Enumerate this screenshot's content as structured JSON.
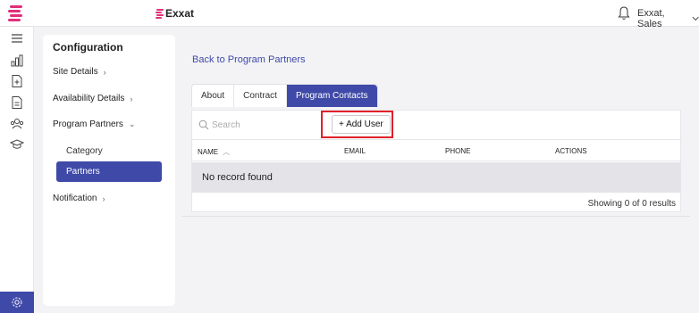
{
  "header": {
    "brand": "Exxat",
    "user_label": "Exxat, Sales",
    "brand_color": "#e0307a",
    "accent_color": "#3f4aa8"
  },
  "rail": {
    "icons": [
      "menu-icon",
      "chart-icon",
      "add-document-icon",
      "document-icon",
      "people-icon",
      "graduation-cap-icon"
    ],
    "bottom_icon": "settings-icon"
  },
  "config": {
    "title": "Configuration",
    "items": [
      {
        "label": "Site Details",
        "chevron": "›"
      },
      {
        "label": "Availability Details",
        "chevron": "›"
      },
      {
        "label": "Program Partners",
        "chevron": "⌄"
      },
      {
        "label": "Notification",
        "chevron": "›"
      }
    ],
    "sub_items": [
      {
        "label": "Category"
      },
      {
        "label": "Partners",
        "active": true
      }
    ]
  },
  "main": {
    "back_link": "Back to Program Partners",
    "tabs": [
      {
        "label": "About"
      },
      {
        "label": "Contract"
      },
      {
        "label": "Program Contacts",
        "active": true
      }
    ],
    "search": {
      "placeholder": "Search"
    },
    "add_user_label": "+ Add User",
    "table": {
      "columns": [
        "NAME",
        "EMAIL",
        "PHONE",
        "ACTIONS"
      ],
      "empty_message": "No record found",
      "footer": "Showing 0 of 0 results"
    }
  }
}
